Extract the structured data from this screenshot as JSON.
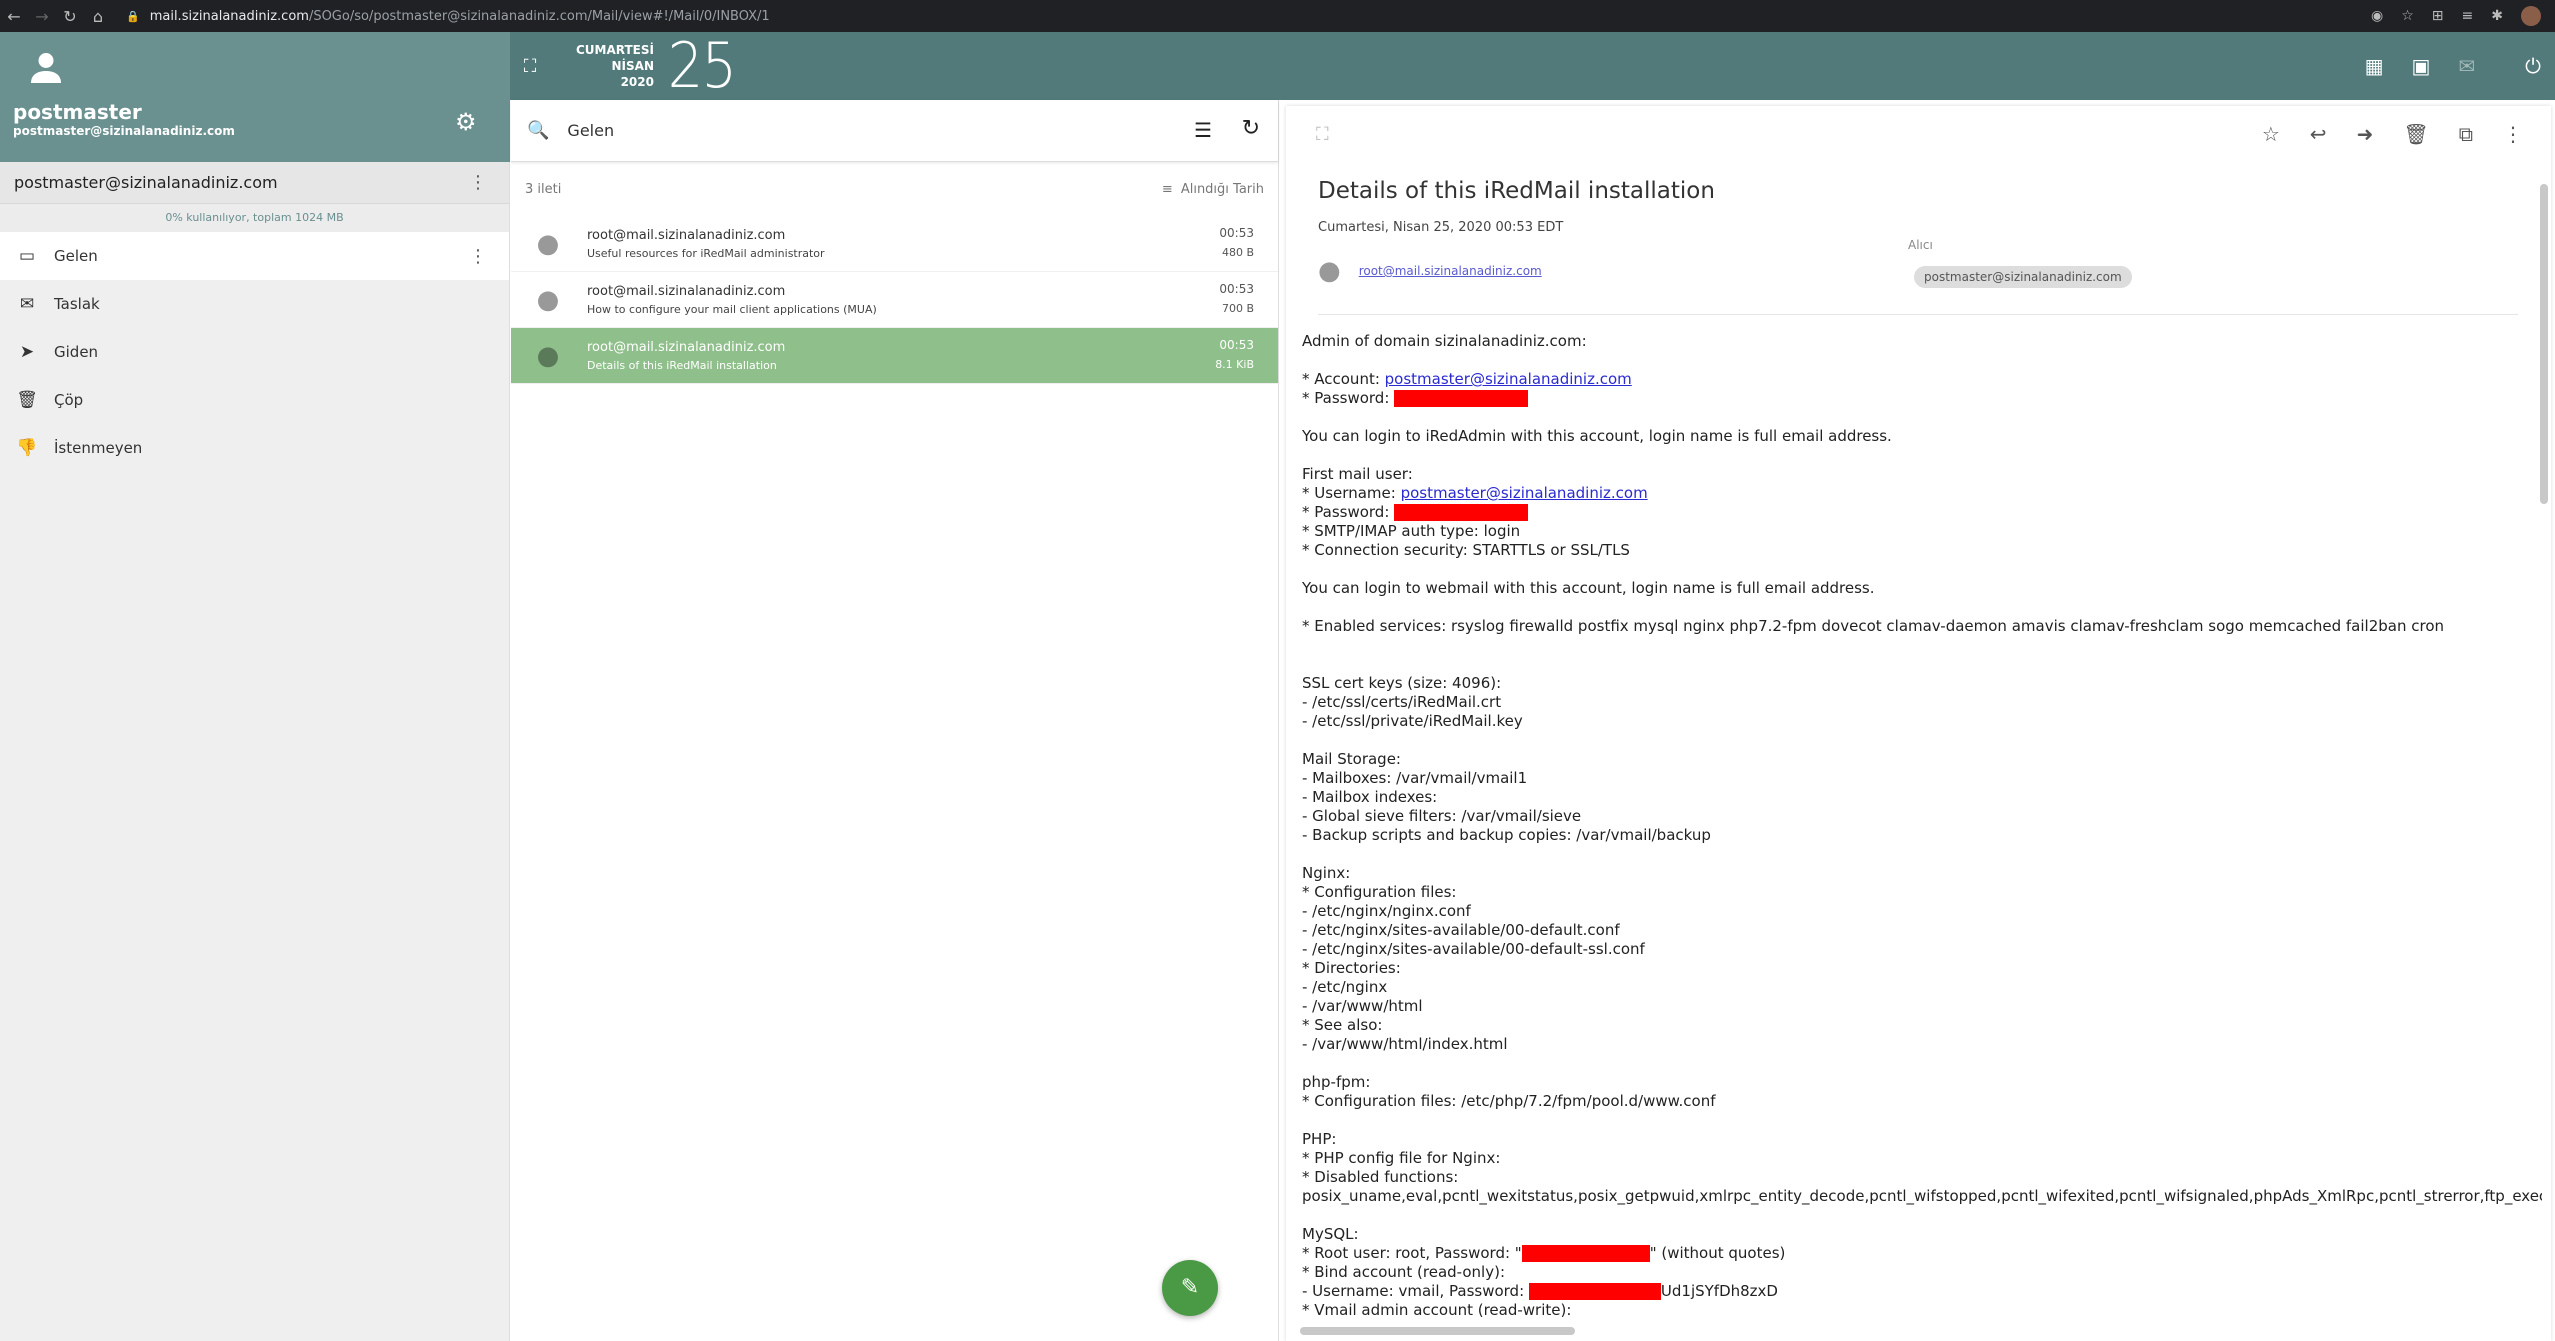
{
  "browser": {
    "url_host": "mail.sizinalanadiniz.com",
    "url_path": "/SOGo/so/postmaster@sizinalanadiniz.com/Mail/view#!/Mail/0/INBOX/1"
  },
  "user": {
    "name": "postmaster",
    "email": "postmaster@sizinalanadiniz.com"
  },
  "date": {
    "weekday": "CUMARTESİ",
    "month": "NİSAN",
    "year": "2020",
    "day": "25"
  },
  "account": {
    "label": "postmaster@sizinalanadiniz.com",
    "quota": "0% kullanılıyor, toplam 1024 MB"
  },
  "folders": [
    {
      "label": "Gelen",
      "icon": "inbox-icon"
    },
    {
      "label": "Taslak",
      "icon": "drafts-icon"
    },
    {
      "label": "Giden",
      "icon": "send-icon"
    },
    {
      "label": "Çöp",
      "icon": "trash-icon"
    },
    {
      "label": "İstenmeyen",
      "icon": "thumbs-down-icon"
    }
  ],
  "list": {
    "search_value": "Gelen",
    "count": "3 ileti",
    "sort_label": "Alındığı Tarih",
    "messages": [
      {
        "from": "root@mail.sizinalanadiniz.com",
        "subject": "Useful resources for iRedMail administrator",
        "time": "00:53",
        "size": "480 B"
      },
      {
        "from": "root@mail.sizinalanadiniz.com",
        "subject": "How to configure your mail client applications (MUA)",
        "time": "00:53",
        "size": "700 B"
      },
      {
        "from": "root@mail.sizinalanadiniz.com",
        "subject": "Details of this iRedMail installation",
        "time": "00:53",
        "size": "8.1 KiB"
      }
    ]
  },
  "viewer": {
    "title": "Details of this iRedMail installation",
    "date": "Cumartesi, Nisan 25, 2020 00:53 EDT",
    "from": "root@mail.sizinalanadiniz.com",
    "to_label": "Alıcı",
    "to": "postmaster@sizinalanadiniz.com",
    "body": {
      "l1": "Admin of domain sizinalanadiniz.com:",
      "l2a": "* Account: ",
      "l2b": "postmaster@sizinalanadiniz.com",
      "l3": "* Password: ",
      "l4": "You can login to iRedAdmin with this account, login name is full email address.",
      "l5": "First mail user:",
      "l6a": "* Username: ",
      "l6b": "postmaster@sizinalanadiniz.com",
      "l7": "* Password: ",
      "l8": "* SMTP/IMAP auth type: login",
      "l9": "* Connection security: STARTTLS or SSL/TLS",
      "l10": "You can login to webmail with this account, login name is full email address.",
      "l11": "* Enabled services: rsyslog firewalld postfix mysql nginx php7.2-fpm dovecot clamav-daemon amavis clamav-freshclam sogo memcached fail2ban cron",
      "l12": "SSL cert keys (size: 4096):\n- /etc/ssl/certs/iRedMail.crt\n- /etc/ssl/private/iRedMail.key",
      "l13": "Mail Storage:\n- Mailboxes: /var/vmail/vmail1\n- Mailbox indexes:\n- Global sieve filters: /var/vmail/sieve\n- Backup scripts and backup copies: /var/vmail/backup",
      "l14": "Nginx:\n* Configuration files:\n- /etc/nginx/nginx.conf\n- /etc/nginx/sites-available/00-default.conf\n- /etc/nginx/sites-available/00-default-ssl.conf\n* Directories:\n- /etc/nginx\n- /var/www/html\n* See also:\n- /var/www/html/index.html",
      "l15": "php-fpm:\n* Configuration files: /etc/php/7.2/fpm/pool.d/www.conf",
      "l16": "PHP:\n* PHP config file for Nginx:\n* Disabled functions: \nposix_uname,eval,pcntl_wexitstatus,posix_getpwuid,xmlrpc_entity_decode,pcntl_wifstopped,pcntl_wifexited,pcntl_wifsignaled,phpAds_XmlRpc,pcntl_strerror,ftp_exec,pcntl_wtermsig,mysql_pconnect,proc_nice,pcntl_sigtimedwait",
      "l17a": "MySQL:\n* Root user: root, Password: \"",
      "l17b": "\" (without quotes)",
      "l18": "* Bind account (read-only):",
      "l19a": "- Username: vmail, Password: ",
      "l19b": "Ud1jSYfDh8zxD",
      "l20": "* Vmail admin account (read-write):"
    }
  }
}
